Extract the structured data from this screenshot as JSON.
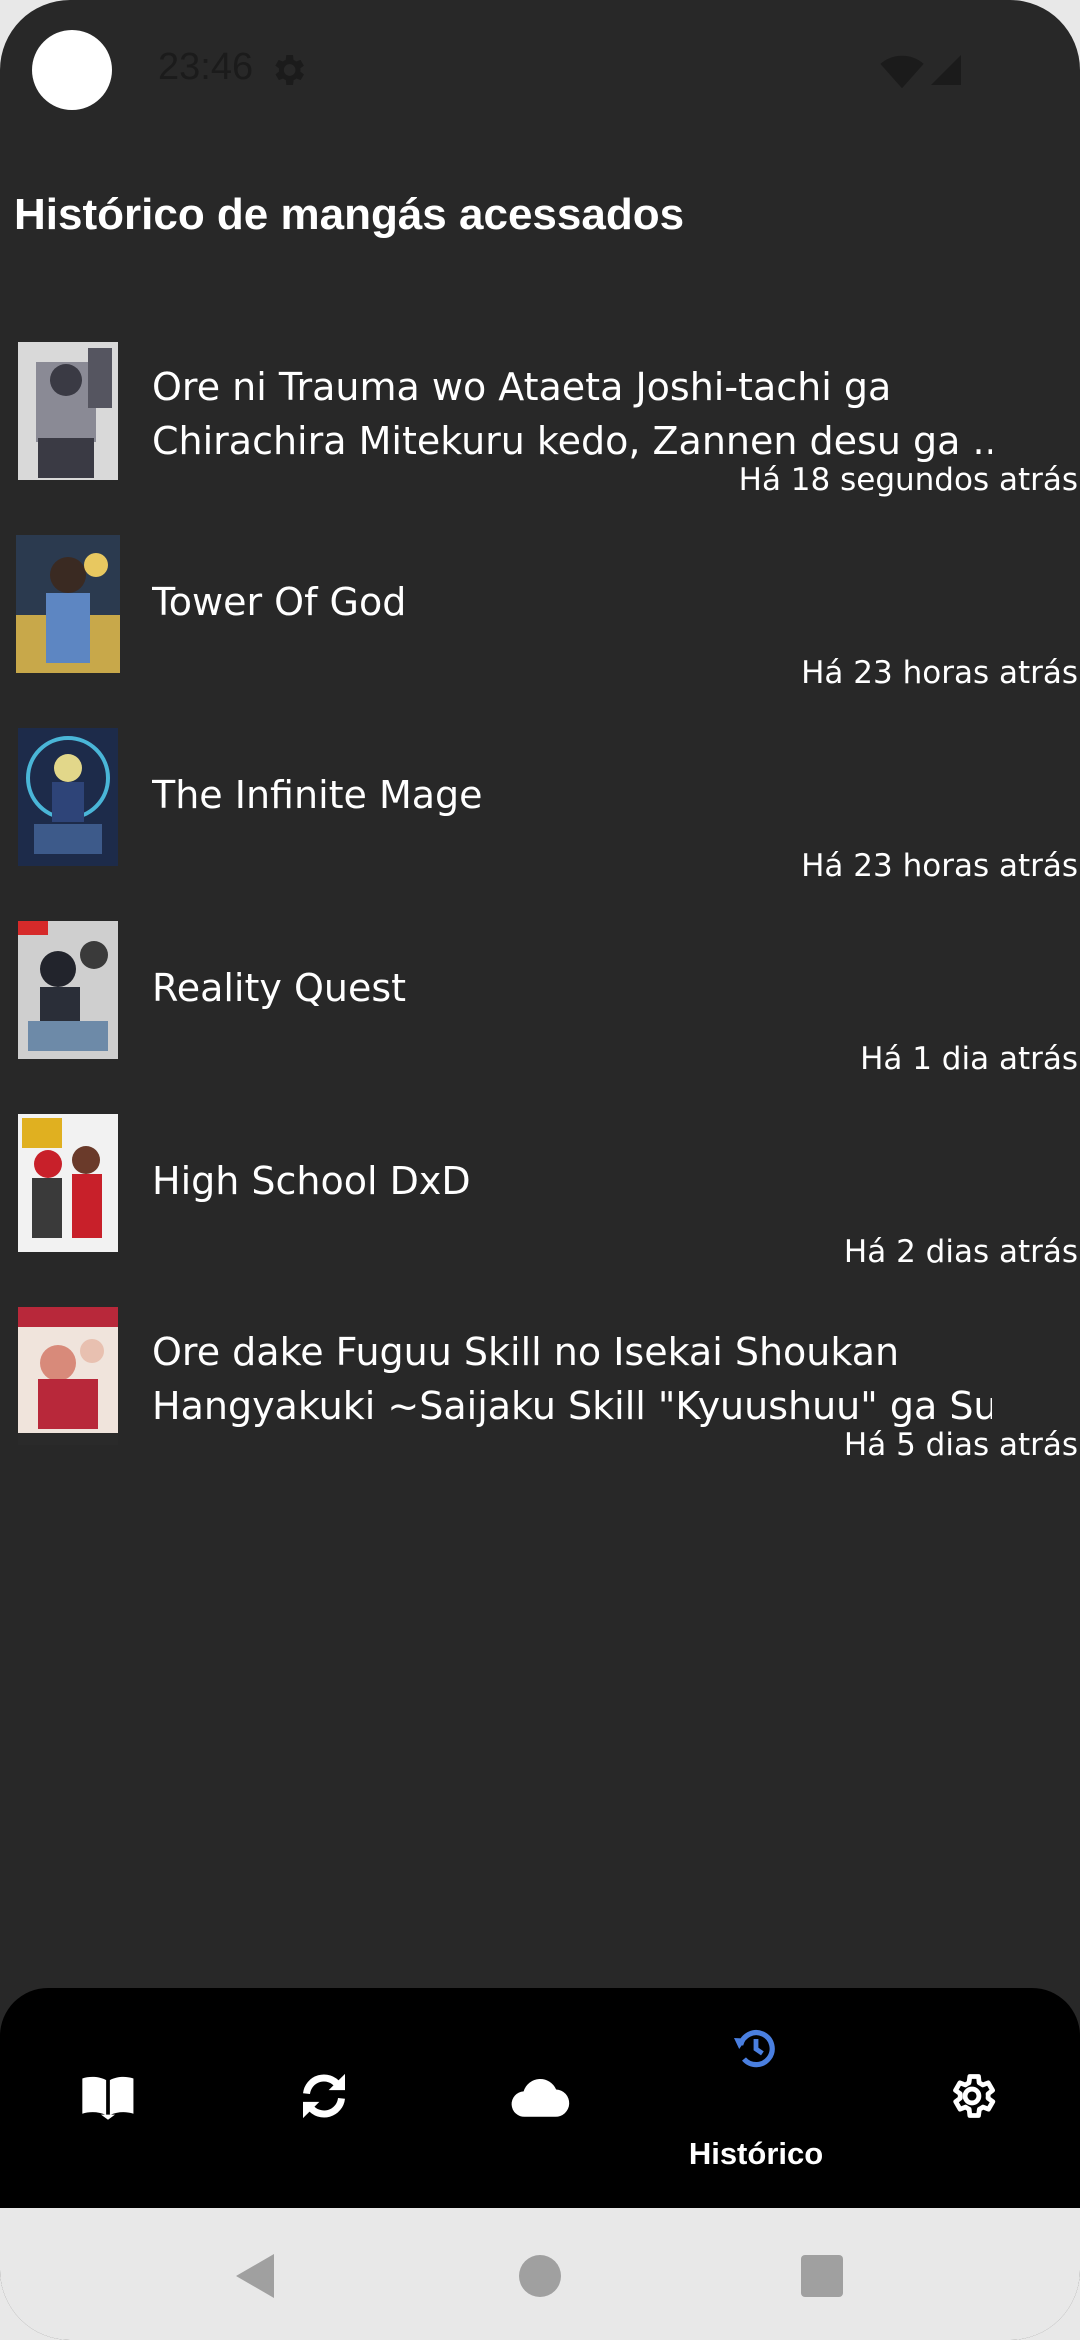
{
  "status_bar": {
    "time": "23:46",
    "icons": [
      "settings-gear-icon",
      "wifi-icon",
      "cell-signal-icon"
    ]
  },
  "page": {
    "title": "Histórico de mangás acessados"
  },
  "history": [
    {
      "title_lines": [
        "Ore ni Trauma wo Ataeta Joshi-tachi ga",
        "Chirachira Mitekuru kedo, Zannen desu ga ..."
      ],
      "time_ago": "Há 18 segundos atrás",
      "cover_colors": [
        "#d9d9d9",
        "#3a3a44",
        "#8a8a95"
      ]
    },
    {
      "title_lines": [
        "Tower Of God"
      ],
      "time_ago": "Há 23 horas atrás",
      "cover_colors": [
        "#2b3a4f",
        "#c8a84a",
        "#5d86c2"
      ]
    },
    {
      "title_lines": [
        "The Infinite Mage"
      ],
      "time_ago": "Há 23 horas atrás",
      "cover_colors": [
        "#1d2b4a",
        "#4ab6d8",
        "#e2d78a"
      ]
    },
    {
      "title_lines": [
        "Reality Quest"
      ],
      "time_ago": "Há 1 dia atrás",
      "cover_colors": [
        "#cfcfcf",
        "#22242c",
        "#6d8aa8"
      ]
    },
    {
      "title_lines": [
        "High School DxD"
      ],
      "time_ago": "Há 2 dias atrás",
      "cover_colors": [
        "#f2f2f2",
        "#c8202a",
        "#3a3a3a"
      ]
    },
    {
      "title_lines": [
        "Ore dake Fuguu Skill no Isekai Shoukan",
        "Hangyakuki ~Saijaku Skill \"Kyuushuu\" ga Su..."
      ],
      "time_ago": "Há 5 dias atrás",
      "cover_colors": [
        "#f0e4dc",
        "#b8283a",
        "#d88a7a"
      ]
    }
  ],
  "bottom_nav": {
    "items": [
      {
        "icon": "book-icon",
        "label": ""
      },
      {
        "icon": "sync-icon",
        "label": ""
      },
      {
        "icon": "cloud-icon",
        "label": ""
      },
      {
        "icon": "history-icon",
        "label": "Histórico",
        "active": true
      },
      {
        "icon": "gear-icon",
        "label": ""
      }
    ],
    "active_color": "#4a7fe0"
  },
  "system_nav": {
    "buttons": [
      "back-icon",
      "home-icon",
      "recents-icon"
    ]
  }
}
